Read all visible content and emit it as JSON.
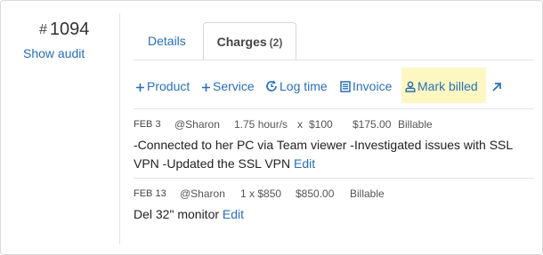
{
  "ticket": {
    "hash": "#",
    "number": "1094",
    "show_audit": "Show audit"
  },
  "tabs": [
    {
      "label": "Details"
    },
    {
      "label": "Charges",
      "count": "(2)"
    }
  ],
  "toolbar": {
    "product": {
      "icon": "plus-icon",
      "label": "Product"
    },
    "service": {
      "icon": "plus-icon",
      "label": "Service"
    },
    "log_time": {
      "icon": "clock-refresh-icon",
      "label": "Log time"
    },
    "invoice": {
      "icon": "invoice-icon",
      "label": "Invoice"
    },
    "mark_billed": {
      "icon": "person-icon",
      "label": "Mark billed"
    },
    "external": {
      "icon": "external-arrow-icon"
    }
  },
  "colors": {
    "link": "#2a6fb5",
    "highlight": "#fdf8c2",
    "border": "#d9d9d9"
  },
  "charges": [
    {
      "date": "FEB 3",
      "user": "@Sharon",
      "qty_rate": "1.75 hour/s",
      "x": "x",
      "price": "$100",
      "total": "$175.00",
      "status": "Billable",
      "description": "-Connected to her PC via Team viewer -Investigated issues with SSL VPN -Updated the SSL VPN",
      "edit": "Edit"
    },
    {
      "date": "FEB 13",
      "user": "@Sharon",
      "qty_rate": "1 x $850",
      "total": "$850.00",
      "status": "Billable",
      "description": "Del 32\" monitor",
      "edit": "Edit"
    }
  ]
}
